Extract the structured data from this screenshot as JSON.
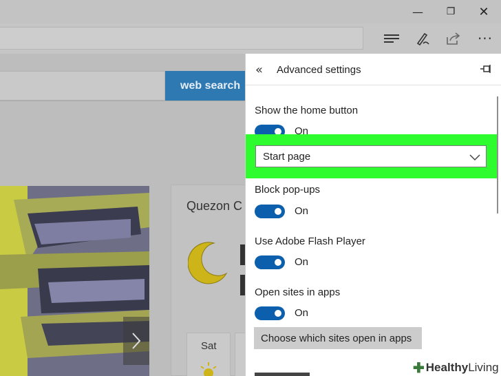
{
  "browser": {
    "window_controls": {
      "minimize": "—",
      "maximize": "❐",
      "close": "✕"
    },
    "toolbar_icons": [
      "hub-icon",
      "web-note-icon",
      "share-icon",
      "more-icon"
    ],
    "more_glyph": "···"
  },
  "page": {
    "search_button": "web search",
    "weather": {
      "city": "Quezon C",
      "day": "Sat"
    }
  },
  "panel": {
    "title": "Advanced settings",
    "settings": [
      {
        "label": "Show the home button",
        "state": "On"
      },
      {
        "label": "Block pop-ups",
        "state": "On"
      },
      {
        "label": "Use Adobe Flash Player",
        "state": "On"
      },
      {
        "label": "Open sites in apps",
        "state": "On"
      }
    ],
    "home_page_select": {
      "selected": "Start page"
    },
    "sites_button": "Choose which sites open in apps"
  },
  "watermark": {
    "part1": "Healthy",
    "part2": " Living"
  },
  "colors": {
    "toggle_on": "#0b5fad",
    "highlight": "#2efc2e",
    "search_button": "#2f79b2"
  }
}
